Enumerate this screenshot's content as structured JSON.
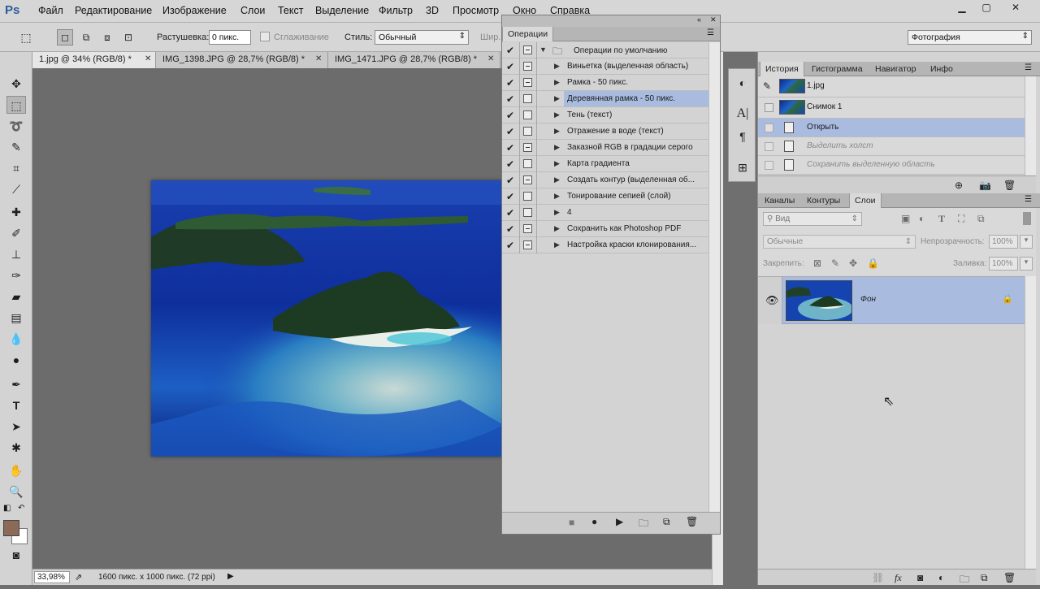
{
  "menubar": {
    "logo": "Ps",
    "items": [
      "Файл",
      "Редактирование",
      "Изображение",
      "Слои",
      "Текст",
      "Выделение",
      "Фильтр",
      "3D",
      "Просмотр",
      "Окно",
      "Справка"
    ]
  },
  "options": {
    "feather_label": "Растушевка:",
    "feather_value": "0 пикс.",
    "antialias_label": "Сглаживание",
    "style_label": "Стиль:",
    "style_value": "Обычный",
    "width_label": "Шир.",
    "workspace": "Фотография"
  },
  "tabs": [
    {
      "label": "1.jpg @ 34% (RGB/8) *"
    },
    {
      "label": "IMG_1398.JPG @ 28,7% (RGB/8) *"
    },
    {
      "label": "IMG_1471.JPG @ 28,7% (RGB/8) *"
    }
  ],
  "status": {
    "zoom": "33,98%",
    "doc_size": "1600 пикс. x 1000 пикс. (72 ppi)"
  },
  "actions_panel": {
    "tab": "Операции",
    "set_name": "Операции по умолчанию",
    "items": [
      {
        "label": "Виньетка (выделенная область)",
        "dialog": true
      },
      {
        "label": "Рамка - 50 пикс.",
        "dialog": true
      },
      {
        "label": "Деревянная рамка - 50 пикс.",
        "dialog": false,
        "selected": true
      },
      {
        "label": "Тень (текст)",
        "dialog": false
      },
      {
        "label": "Отражение в воде (текст)",
        "dialog": false
      },
      {
        "label": "Заказной RGB в градации серого",
        "dialog": true
      },
      {
        "label": "Карта градиента",
        "dialog": false
      },
      {
        "label": "Создать контур (выделенная об...",
        "dialog": true
      },
      {
        "label": "Тонирование сепией (слой)",
        "dialog": false
      },
      {
        "label": "4",
        "dialog": false
      },
      {
        "label": "Сохранить как Photoshop PDF",
        "dialog": true
      },
      {
        "label": "Настройка краски клонирования...",
        "dialog": true
      }
    ]
  },
  "history_panel": {
    "tabs": [
      "История",
      "Гистограмма",
      "Навигатор",
      "Инфо"
    ],
    "snapshot_doc": "1.jpg",
    "snapshot_1": "Снимок 1",
    "steps": [
      {
        "label": "Открыть",
        "state": "current"
      },
      {
        "label": "Выделить холст",
        "state": "undone"
      },
      {
        "label": "Сохранить выделенную область",
        "state": "undone"
      }
    ]
  },
  "layers_panel": {
    "tabs": [
      "Каналы",
      "Контуры",
      "Слои"
    ],
    "filter_placeholder": "Вид",
    "blend_mode": "Обычные",
    "opacity_label": "Непрозрачность:",
    "opacity_value": "100%",
    "lock_label": "Закрепить:",
    "fill_label": "Заливка:",
    "fill_value": "100%",
    "layer_name": "Фон"
  },
  "colors": {
    "selection_blue": "#a9bce0",
    "panel_bg": "#d3d3d3",
    "canvas_bg": "#6c6c6c",
    "foreground_swatch": "#8b6a58",
    "background_swatch": "#ffffff"
  }
}
